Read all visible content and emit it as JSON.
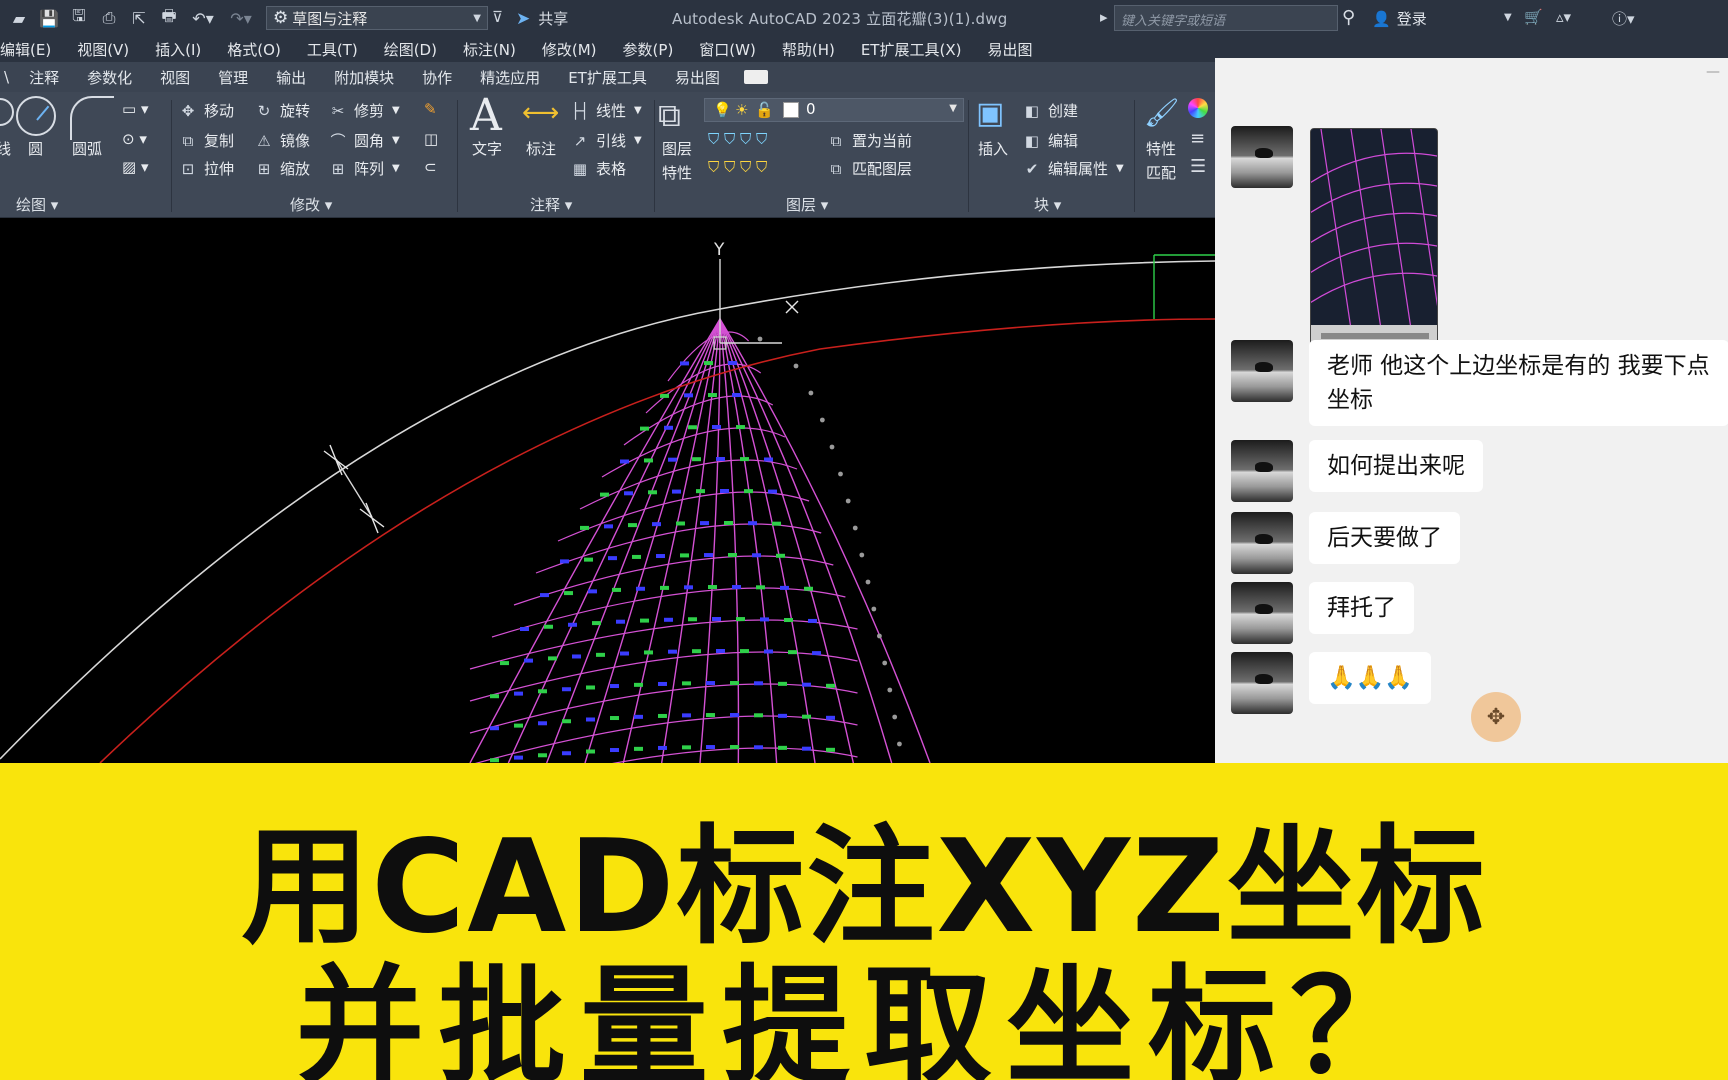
{
  "titlebar": {
    "workspace": "草图与注释",
    "share": "共享",
    "app_title": "Autodesk AutoCAD 2023    立面花瓣(3)(1).dwg",
    "search_placeholder": "键入关键字或短语",
    "login": "登录"
  },
  "menu": [
    "编辑(E)",
    "视图(V)",
    "插入(I)",
    "格式(O)",
    "工具(T)",
    "绘图(D)",
    "标注(N)",
    "修改(M)",
    "参数(P)",
    "窗口(W)",
    "帮助(H)",
    "ET扩展工具(X)",
    "易出图"
  ],
  "ribbon_tabs": [
    "注释",
    "参数化",
    "视图",
    "管理",
    "输出",
    "附加模块",
    "协作",
    "精选应用",
    "ET扩展工具",
    "易出图"
  ],
  "ribbon": {
    "draw": {
      "line": "线",
      "circle": "圆",
      "arc": "圆弧",
      "panel": "绘图"
    },
    "modify": {
      "move": "移动",
      "rotate": "旋转",
      "trim": "修剪",
      "copy": "复制",
      "mirror": "镜像",
      "fillet": "圆角",
      "stretch": "拉伸",
      "scale": "缩放",
      "array": "阵列",
      "panel": "修改"
    },
    "annotation": {
      "text": "文字",
      "dimension": "标注",
      "linear": "线性",
      "leader": "引线",
      "table": "表格",
      "panel": "注释"
    },
    "layers": {
      "layer_props_1": "图层",
      "layer_props_2": "特性",
      "current_layer": "0",
      "set_current": "置为当前",
      "match_layer": "匹配图层",
      "panel": "图层"
    },
    "block": {
      "insert": "插入",
      "create": "创建",
      "edit": "编辑",
      "edit_attr": "编辑属性",
      "panel": "块"
    },
    "properties": {
      "match_1": "特性",
      "match_2": "匹配"
    }
  },
  "canvas": {
    "ucs_y": "Y"
  },
  "chat": {
    "messages": [
      "老师   他这个上边坐标是有的   我要下点坐标",
      "如何提出来呢",
      "后天要做了",
      "拜托了",
      "🙏🙏🙏"
    ]
  },
  "caption": {
    "line1": "用CAD标注XYZ坐标",
    "line2": "并批量提取坐标？"
  },
  "colors": {
    "caption_bg": "#f9e40c",
    "titlebar_bg": "#2b3340",
    "ribbon_bg": "#3f4856"
  }
}
